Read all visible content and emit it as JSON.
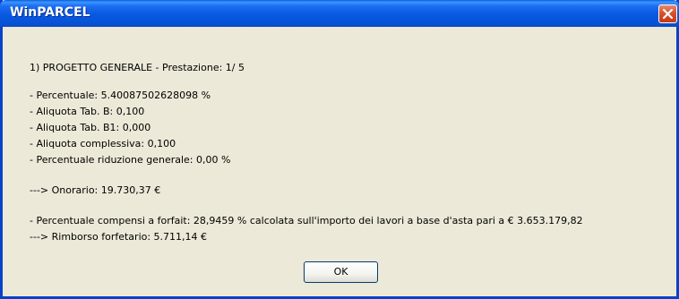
{
  "window": {
    "title": "WinPARCEL"
  },
  "icons": {
    "close": "close-x-icon"
  },
  "colors": {
    "titlebar": "#0a5ae3",
    "close_button": "#d8512b",
    "background": "#ece9d8"
  },
  "message": {
    "heading": "1) PROGETTO GENERALE - Prestazione:  1/ 5",
    "percentuale": "- Percentuale:  5.40087502628098 %",
    "aliquota_b": "- Aliquota Tab. B: 0,100",
    "aliquota_b1": "- Aliquota Tab. B1: 0,000",
    "aliquota_complessiva": "- Aliquota complessiva: 0,100",
    "riduzione": "- Percentuale riduzione generale: 0,00 %",
    "onorario": "---> Onorario: 19.730,37 €",
    "compensi_forfait": "- Percentuale compensi a forfait: 28,9459 % calcolata sull'importo dei lavori a base d'asta pari a € 3.653.179,82",
    "rimborso": "---> Rimborso forfetario: 5.711,14 €"
  },
  "buttons": {
    "ok_label": "OK"
  }
}
